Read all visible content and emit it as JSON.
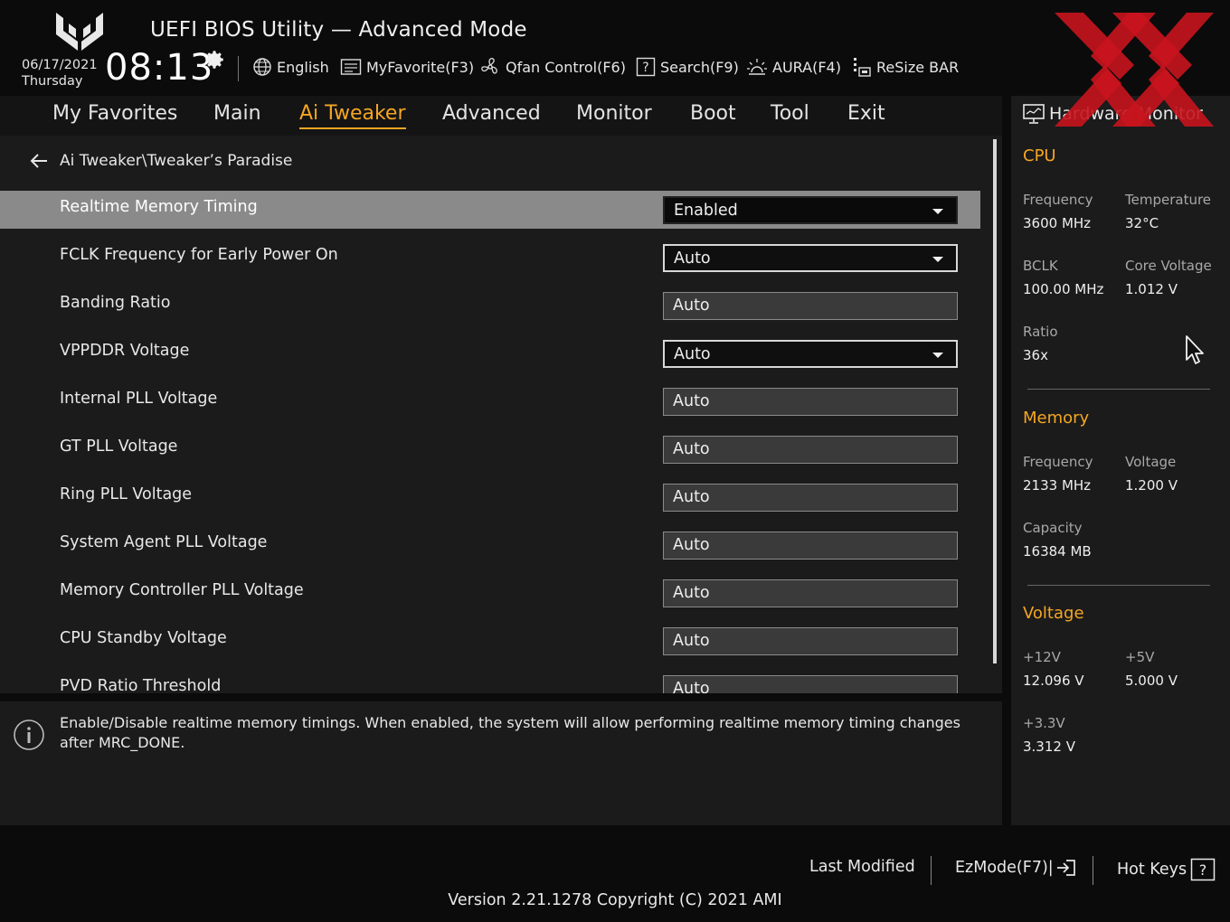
{
  "header": {
    "app_title": "UEFI BIOS Utility — Advanced Mode",
    "date": "06/17/2021",
    "weekday": "Thursday",
    "time": "08:13",
    "toolbar": [
      {
        "label": "English",
        "icon": "globe-icon"
      },
      {
        "label": "MyFavorite(F3)",
        "icon": "favorite-list-icon"
      },
      {
        "label": "Qfan Control(F6)",
        "icon": "fan-icon"
      },
      {
        "label": "Search(F9)",
        "icon": "question-box-icon"
      },
      {
        "label": "AURA(F4)",
        "icon": "aura-light-icon"
      },
      {
        "label": "ReSize BAR",
        "icon": "resize-bar-icon"
      }
    ]
  },
  "nav": {
    "tabs": [
      "My Favorites",
      "Main",
      "Ai Tweaker",
      "Advanced",
      "Monitor",
      "Boot",
      "Tool",
      "Exit"
    ],
    "active": "Ai Tweaker"
  },
  "breadcrumb": "Ai Tweaker\\Tweaker’s Paradise",
  "settings": [
    {
      "label": "Realtime Memory Timing",
      "value": "Enabled",
      "type": "dropdown",
      "selected": true
    },
    {
      "label": "FCLK Frequency for Early Power On",
      "value": "Auto",
      "type": "dropdown"
    },
    {
      "label": "Banding Ratio",
      "value": "Auto",
      "type": "input"
    },
    {
      "label": "VPPDDR Voltage",
      "value": "Auto",
      "type": "dropdown"
    },
    {
      "label": "Internal PLL Voltage",
      "value": "Auto",
      "type": "input"
    },
    {
      "label": "GT PLL Voltage",
      "value": "Auto",
      "type": "input"
    },
    {
      "label": "Ring PLL Voltage",
      "value": "Auto",
      "type": "input"
    },
    {
      "label": "System Agent PLL Voltage",
      "value": "Auto",
      "type": "input"
    },
    {
      "label": "Memory Controller PLL Voltage",
      "value": "Auto",
      "type": "input"
    },
    {
      "label": "CPU Standby Voltage",
      "value": "Auto",
      "type": "input"
    },
    {
      "label": "PVD Ratio Threshold",
      "value": "Auto",
      "type": "input"
    }
  ],
  "help_text": "Enable/Disable realtime memory timings. When enabled, the system will allow performing realtime memory timing changes after MRC_DONE.",
  "hw_monitor": {
    "title": "Hardware Monitor",
    "cpu": {
      "heading": "CPU",
      "frequency_label": "Frequency",
      "frequency": "3600 MHz",
      "temperature_label": "Temperature",
      "temperature": "32°C",
      "bclk_label": "BCLK",
      "bclk": "100.00 MHz",
      "core_voltage_label": "Core Voltage",
      "core_voltage": "1.012 V",
      "ratio_label": "Ratio",
      "ratio": "36x"
    },
    "memory": {
      "heading": "Memory",
      "frequency_label": "Frequency",
      "frequency": "2133 MHz",
      "voltage_label": "Voltage",
      "voltage": "1.200 V",
      "capacity_label": "Capacity",
      "capacity": "16384 MB"
    },
    "voltage": {
      "heading": "Voltage",
      "v12_label": "+12V",
      "v12": "12.096 V",
      "v5_label": "+5V",
      "v5": "5.000 V",
      "v33_label": "+3.3V",
      "v33": "3.312 V"
    }
  },
  "footer": {
    "last_modified": "Last Modified",
    "ezmode": "EzMode(F7)|",
    "hotkeys": "Hot Keys",
    "version": "Version 2.21.1278 Copyright (C) 2021 AMI"
  },
  "colors": {
    "accent": "#f5a623",
    "selected_row": "#8a8a8a",
    "panel": "#1b1b1b",
    "background": "#0b0b0b",
    "watermark": "#c8141e"
  }
}
